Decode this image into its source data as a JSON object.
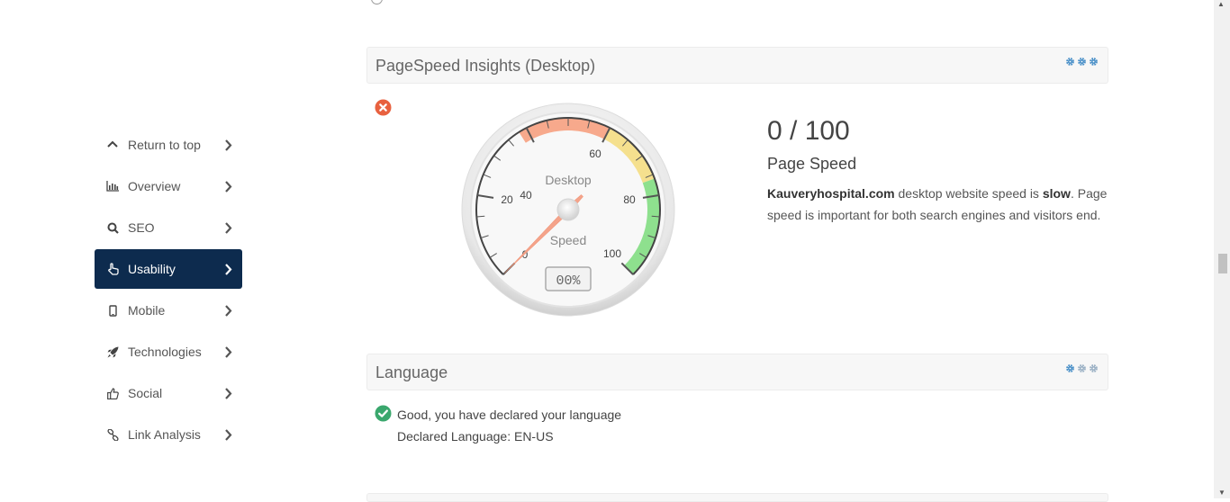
{
  "sidebar": {
    "items": [
      {
        "label": "Return to top",
        "icon": "chevron-up-icon"
      },
      {
        "label": "Overview",
        "icon": "bar-chart-icon"
      },
      {
        "label": "SEO",
        "icon": "search-icon"
      },
      {
        "label": "Usability",
        "icon": "pointer-hand-icon",
        "active": true
      },
      {
        "label": "Mobile",
        "icon": "mobile-icon"
      },
      {
        "label": "Technologies",
        "icon": "rocket-icon"
      },
      {
        "label": "Social",
        "icon": "thumbs-up-icon"
      },
      {
        "label": "Link Analysis",
        "icon": "link-icon"
      }
    ]
  },
  "pagespeed": {
    "title": "PageSpeed Insights (Desktop)",
    "score": "0 / 100",
    "score_label": "Page Speed",
    "status": "error",
    "gauge": {
      "top_label": "Desktop",
      "bottom_label": "Speed",
      "ticks": [
        "0",
        "20",
        "40",
        "60",
        "80",
        "100"
      ],
      "readout": "00%",
      "value": 0
    },
    "desc_site": "Kauveryhospital.com",
    "desc_mid": " desktop website speed is ",
    "desc_bold": "slow",
    "desc_end": ". Page speed is important for both search engines and visitors end."
  },
  "language": {
    "title": "Language",
    "status": "ok",
    "line1": "Good, you have declared your language",
    "line2": "Declared Language: EN-US"
  },
  "colors": {
    "nav_active": "#0d2b4e",
    "error": "#e8613f",
    "success": "#3aa76d",
    "gear": "#4a90c8"
  }
}
